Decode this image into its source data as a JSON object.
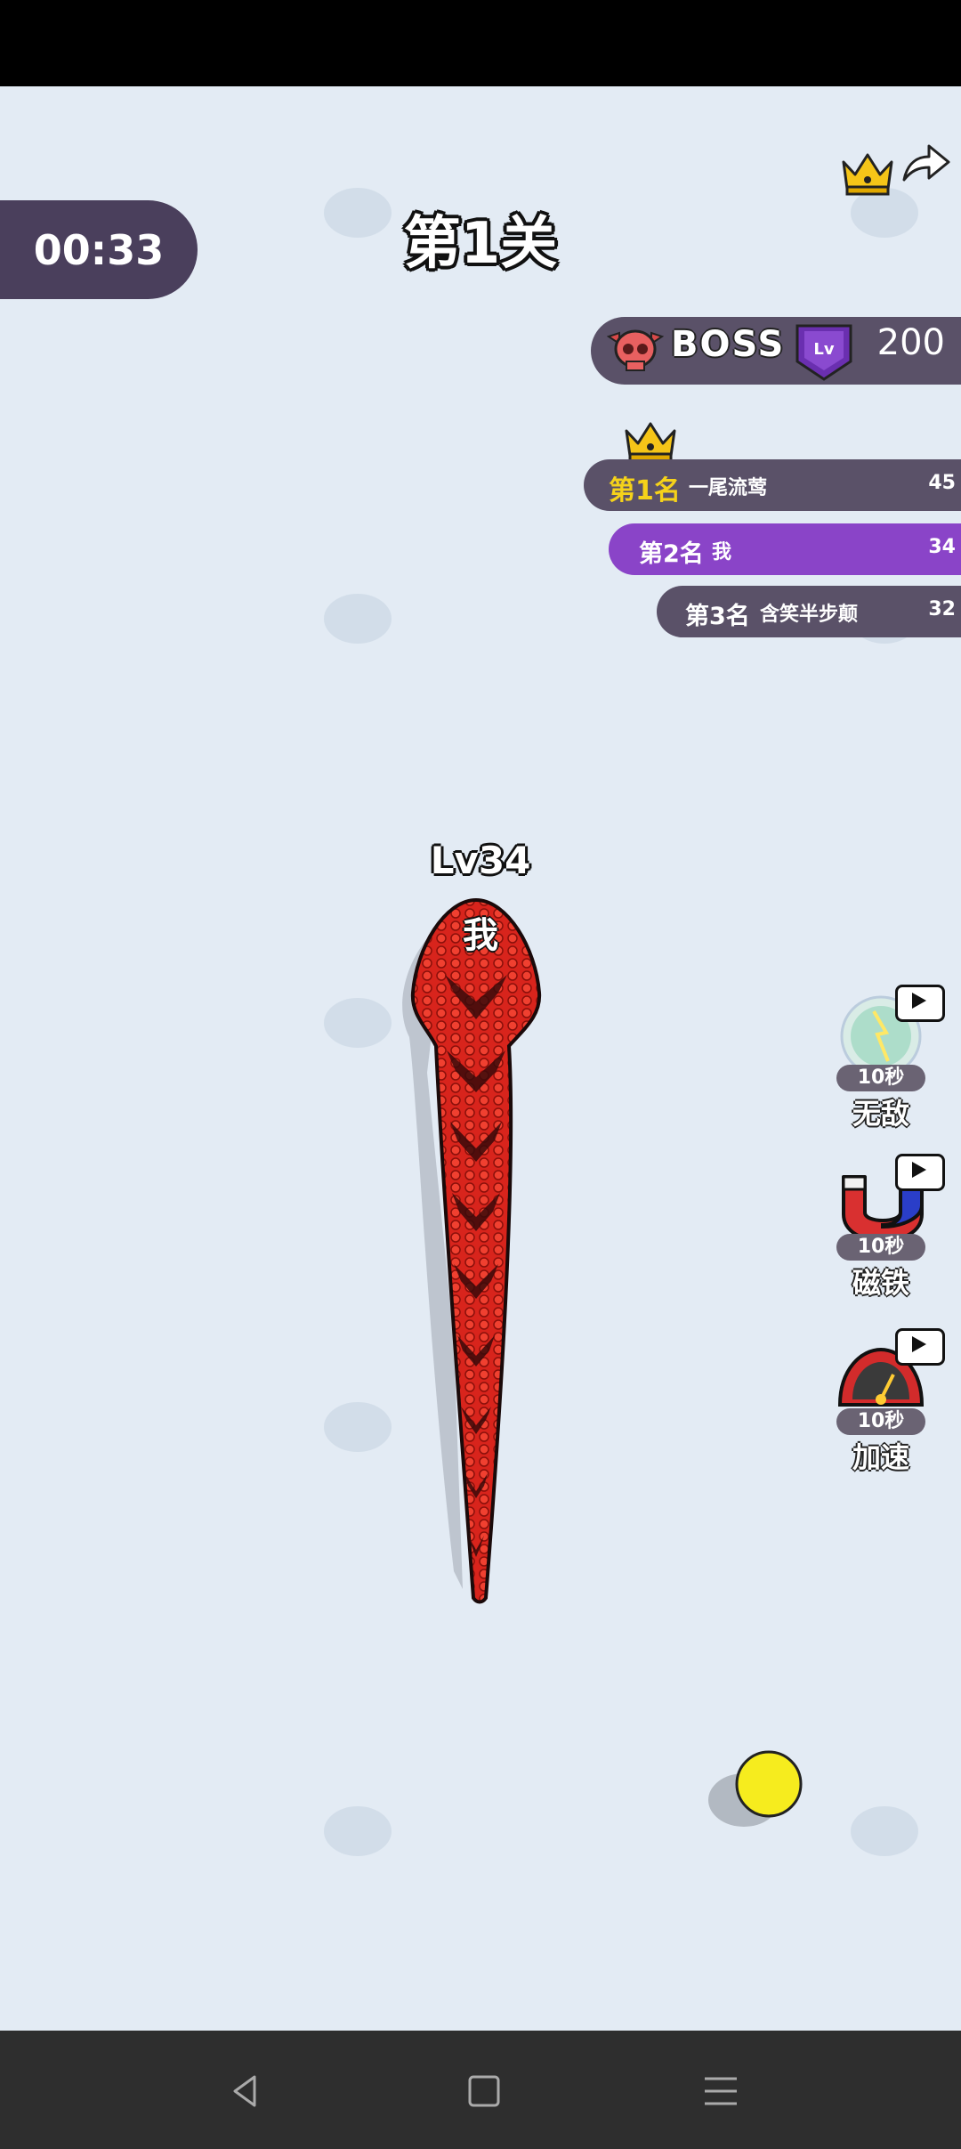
{
  "hud": {
    "timer": "00:33",
    "level_title": "第1关"
  },
  "boss": {
    "label": "BOSS",
    "badge_text": "Lv",
    "value": "200"
  },
  "leaderboard": [
    {
      "rank": "第1名",
      "name": "一尾流莺",
      "score": "45"
    },
    {
      "rank": "第2名",
      "name": "我",
      "score": "34"
    },
    {
      "rank": "第3名",
      "name": "含笑半步颠",
      "score": "32"
    }
  ],
  "player": {
    "level": "Lv34",
    "name": "我"
  },
  "powerups": [
    {
      "duration": "10秒",
      "label": "无敌",
      "icon": "invincible-orb-icon"
    },
    {
      "duration": "10秒",
      "label": "磁铁",
      "icon": "magnet-icon"
    },
    {
      "duration": "10秒",
      "label": "加速",
      "icon": "speedometer-icon"
    }
  ],
  "colors": {
    "background": "#e3ebf4",
    "panel": "#4a3f5c",
    "highlight_row": "#8a44c8",
    "gold": "#f5d21a",
    "snake": "#d8241c"
  }
}
